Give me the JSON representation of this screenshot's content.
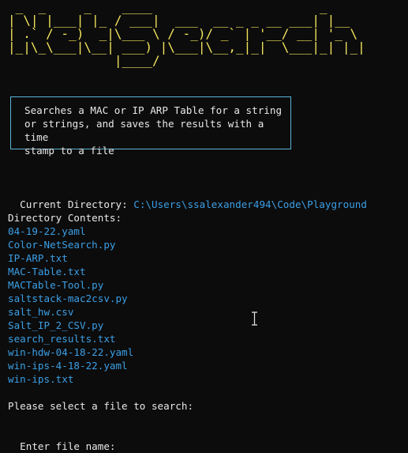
{
  "banner": {
    "text": " _  _     _    ____                      _     \n| \\| |___| |_ / ___|  ___  __ _ _ __ ___| |__  \n| .` / -_)  _|\\___ \\ / -_)/ _` | '__/ __| '_ \\ \n|_|\\_\\___|\\__| ___) |\\___|\\__,_|_|  \\___|_| |_|\n              |____/                          ",
    "color": "#f2e35b"
  },
  "description": "Searches a MAC or IP ARP Table for a string\nor strings, and saves the results with a time\nstamp to a file",
  "current_directory": {
    "label": "Current Directory: ",
    "path": "C:\\Users\\ssalexander494\\Code\\Playground"
  },
  "directory_contents": {
    "label": "Directory Contents:",
    "files": [
      "04-19-22.yaml",
      "Color-NetSearch.py",
      "IP-ARP.txt",
      "MAC-Table.txt",
      "MACTable-Tool.py",
      "saltstack-mac2csv.py",
      "salt_hw.csv",
      "Salt_IP_2_CSV.py",
      "search_results.txt",
      "win-hdw-04-18-22.yaml",
      "win-ips-4-18-22.yaml",
      "win-ips.txt"
    ]
  },
  "prompts": {
    "select_file": "Please select a file to search:",
    "enter_file": "Enter file name:"
  },
  "colors": {
    "background": "#0c0c0c",
    "text": "#cccccc",
    "accent": "#3b9fe6",
    "box_border": "#5ab4d6"
  },
  "mouse_cursor_icon": "i-beam-cursor-icon"
}
